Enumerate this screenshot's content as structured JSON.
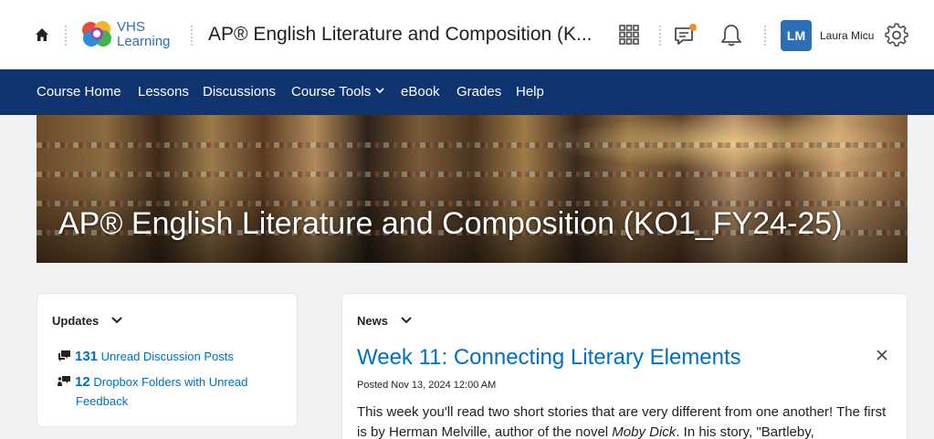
{
  "header": {
    "logo_line1": "VHS",
    "logo_line2": "Learning",
    "course_title": "AP® English Literature and Composition (K...",
    "user_initials": "LM",
    "user_name": "Laura Micu",
    "icons": [
      "home-icon",
      "waffle-grid-icon",
      "message-alert-icon",
      "bell-icon",
      "gear-icon"
    ],
    "accent_color": "#2c6fb7",
    "notification_dot_color": "#f08a24"
  },
  "nav": {
    "items": [
      "Course Home",
      "Lessons",
      "Discussions",
      "Course Tools",
      "eBook",
      "Grades",
      "Help"
    ],
    "background": "#10346f"
  },
  "banner": {
    "title": "AP® English Literature and Composition (KO1_FY24-25)"
  },
  "updates": {
    "heading": "Updates",
    "discussion_count": "131",
    "discussion_label": "Unread Discussion Posts",
    "dropbox_count": "12",
    "dropbox_label_1": "Dropbox Folders with Unread",
    "dropbox_label_2": "Feedback"
  },
  "news": {
    "heading": "News",
    "title": "Week 11: Connecting Literary Elements",
    "posted": "Posted Nov 13, 2024 12:00 AM",
    "body_1": "This week you'll read two short stories that are very different from one another! The first is by Herman Melville, author of the novel ",
    "body_italic": "Moby Dick",
    "body_2": ". In his story, \"Bartleby,",
    "link_color": "#006fbf"
  }
}
